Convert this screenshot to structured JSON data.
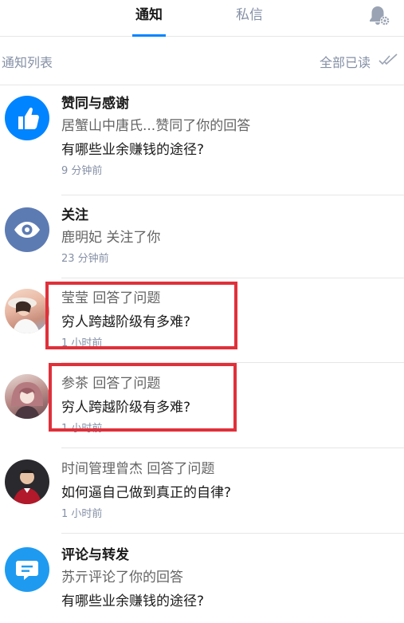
{
  "tabs": {
    "notify": "通知",
    "messages": "私信"
  },
  "list_header": {
    "title": "通知列表",
    "mark_all_read": "全部已读"
  },
  "items": [
    {
      "kind": "like",
      "title": "赞同与感谢",
      "sub": "居蟹山中唐氏...赞同了你的回答",
      "main": "有哪些业余赚钱的途径?",
      "time": "9 分钟前",
      "avatar_color": "#0084ff"
    },
    {
      "kind": "follow",
      "title": "关注",
      "sub": "鹿明妃 关注了你",
      "main": "",
      "time": "23 分钟前",
      "avatar_color": "#5d7bb3"
    },
    {
      "kind": "answer",
      "title": "",
      "sub": "莹莹 回答了问题",
      "main": "穷人跨越阶级有多难?",
      "time": "1 小时前"
    },
    {
      "kind": "answer",
      "title": "",
      "sub": "参茶 回答了问题",
      "main": "穷人跨越阶级有多难?",
      "time": "1 小时前"
    },
    {
      "kind": "answer",
      "title": "",
      "sub": "时间管理曾杰 回答了问题",
      "main": "如何逼自己做到真正的自律?",
      "time": "1 小时前"
    },
    {
      "kind": "comment",
      "title": "评论与转发",
      "sub": "苏亓评论了你的回答",
      "main": "有哪些业余赚钱的途径?",
      "time": "",
      "avatar_color": "#1e9bf0"
    }
  ],
  "colors": {
    "accent": "#0084ff",
    "highlight": "#e0303a"
  }
}
